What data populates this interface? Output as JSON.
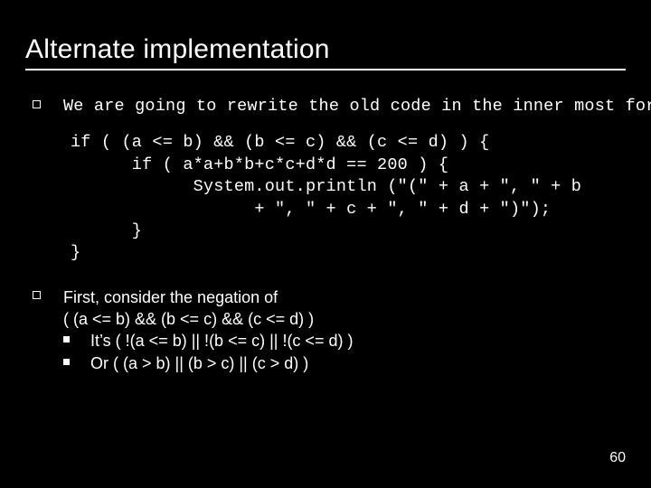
{
  "title": "Alternate implementation",
  "intro": "We are going to rewrite the old code in the inner most for loop:",
  "code": {
    "l1": "if ( (a <= b) && (b <= c) && (c <= d) ) {",
    "l2": "      if ( a*a+b*b+c*c+d*d == 200 ) {",
    "l3": "            System.out.println (\"(\" + a + \", \" + b",
    "l4": "                  + \", \" + c + \", \" + d + \")\");",
    "l5": "      }",
    "l6": "}"
  },
  "neg": {
    "lead": "First, consider the negation of",
    "expr": "( (a <= b) && (b <= c) && (c <= d) )",
    "s1": "It’s ( !(a <= b) || !(b <= c) || !(c <= d) )",
    "s2": "Or ( (a > b) || (b > c) || (c > d) )"
  },
  "page": "60"
}
